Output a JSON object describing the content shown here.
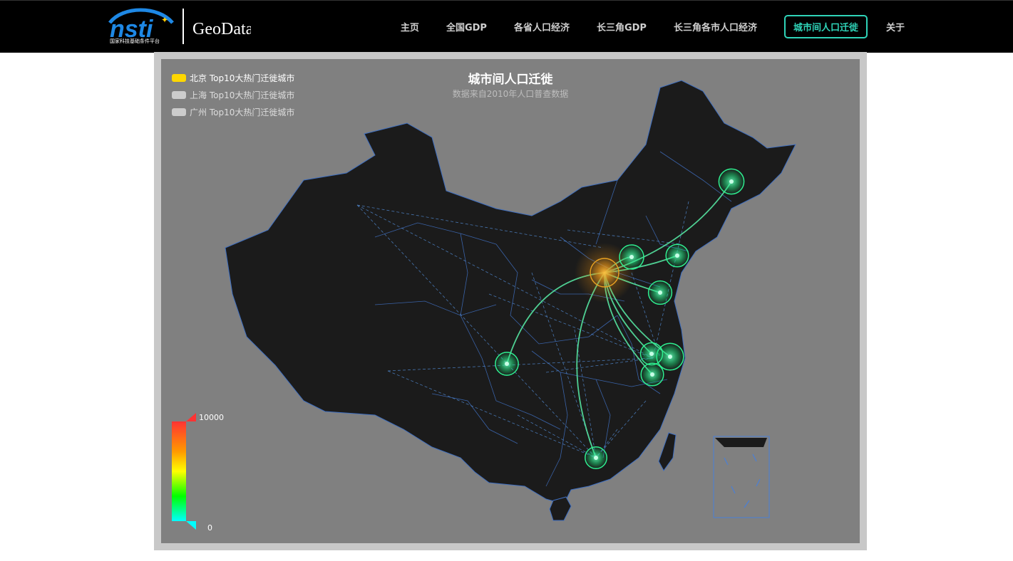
{
  "header": {
    "logo_text": "nsti",
    "logo_caption": "国家科技基础条件平台",
    "site_name": "GeoData.cn",
    "nav": [
      {
        "label": "主页",
        "active": false
      },
      {
        "label": "全国GDP",
        "active": false
      },
      {
        "label": "各省人口经济",
        "active": false
      },
      {
        "label": "长三角GDP",
        "active": false
      },
      {
        "label": "长三角各市人口经济",
        "active": false
      },
      {
        "label": "城市间人口迁徙",
        "active": true
      },
      {
        "label": "关于",
        "active": false
      }
    ]
  },
  "map": {
    "title": "城市间人口迁徙",
    "subtitle": "数据来自2010年人口普查数据",
    "legend": [
      {
        "label": "北京 Top10大热门迁徙城市",
        "color": "#ffd700",
        "selected": true
      },
      {
        "label": "上海 Top10大热门迁徙城市",
        "color": "#cccccc",
        "selected": false
      },
      {
        "label": "广州 Top10大热门迁徙城市",
        "color": "#cccccc",
        "selected": false
      }
    ],
    "visual_map": {
      "max_label": "10000",
      "min_label": "0",
      "max": 10000,
      "min": 0,
      "colors": [
        "#ff3333",
        "#ff9900",
        "#ffff00",
        "#00ff00",
        "#00ffff"
      ]
    },
    "colors": {
      "land": "#1b1b1b",
      "border": "#4a7fd6",
      "background": "#808080",
      "flow_line": "#58f0a8",
      "origin": "#f0a020"
    },
    "origin_city": {
      "value": 7800
    },
    "flows": [
      {
        "value": 3200
      },
      {
        "value": 3000
      },
      {
        "value": 2600
      },
      {
        "value": 2800
      },
      {
        "value": 3600
      },
      {
        "value": 2500
      },
      {
        "value": 2600
      },
      {
        "value": 2700
      },
      {
        "value": 2400
      }
    ]
  }
}
